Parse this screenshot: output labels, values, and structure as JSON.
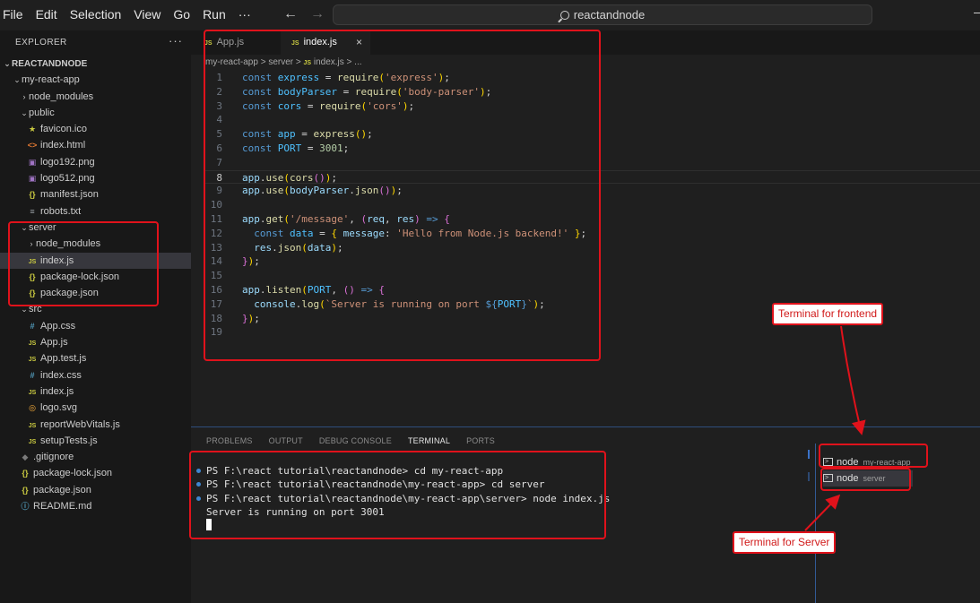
{
  "menu": [
    "File",
    "Edit",
    "Selection",
    "View",
    "Go",
    "Run",
    "···"
  ],
  "search": {
    "text": "reactandnode"
  },
  "sidebar": {
    "title": "EXPLORER",
    "more": "···",
    "tree": [
      {
        "label": "REACTANDNODE",
        "depth": 0,
        "type": "folder",
        "open": true,
        "root": true
      },
      {
        "label": "my-react-app",
        "depth": 1,
        "type": "folder",
        "open": true
      },
      {
        "label": "node_modules",
        "depth": 2,
        "type": "folder",
        "open": false
      },
      {
        "label": "public",
        "depth": 2,
        "type": "folder",
        "open": true
      },
      {
        "label": "favicon.ico",
        "depth": 3,
        "type": "star"
      },
      {
        "label": "index.html",
        "depth": 3,
        "type": "html"
      },
      {
        "label": "logo192.png",
        "depth": 3,
        "type": "img"
      },
      {
        "label": "logo512.png",
        "depth": 3,
        "type": "img"
      },
      {
        "label": "manifest.json",
        "depth": 3,
        "type": "json"
      },
      {
        "label": "robots.txt",
        "depth": 3,
        "type": "txt"
      },
      {
        "label": "server",
        "depth": 2,
        "type": "folder",
        "open": true
      },
      {
        "label": "node_modules",
        "depth": 3,
        "type": "folder",
        "open": false
      },
      {
        "label": "index.js",
        "depth": 3,
        "type": "js",
        "selected": true
      },
      {
        "label": "package-lock.json",
        "depth": 3,
        "type": "json"
      },
      {
        "label": "package.json",
        "depth": 3,
        "type": "json"
      },
      {
        "label": "src",
        "depth": 2,
        "type": "folder",
        "open": true
      },
      {
        "label": "App.css",
        "depth": 3,
        "type": "css"
      },
      {
        "label": "App.js",
        "depth": 3,
        "type": "js"
      },
      {
        "label": "App.test.js",
        "depth": 3,
        "type": "js"
      },
      {
        "label": "index.css",
        "depth": 3,
        "type": "css"
      },
      {
        "label": "index.js",
        "depth": 3,
        "type": "js"
      },
      {
        "label": "logo.svg",
        "depth": 3,
        "type": "svg"
      },
      {
        "label": "reportWebVitals.js",
        "depth": 3,
        "type": "js"
      },
      {
        "label": "setupTests.js",
        "depth": 3,
        "type": "js"
      },
      {
        "label": ".gitignore",
        "depth": 2,
        "type": "git"
      },
      {
        "label": "package-lock.json",
        "depth": 2,
        "type": "json"
      },
      {
        "label": "package.json",
        "depth": 2,
        "type": "json"
      },
      {
        "label": "README.md",
        "depth": 2,
        "type": "info"
      }
    ]
  },
  "editor": {
    "tabs": [
      {
        "label": "App.js",
        "icon": "JS"
      },
      {
        "label": "index.js",
        "icon": "JS",
        "close": "×"
      }
    ],
    "breadcrumb": {
      "parts": [
        "my-react-app",
        "server"
      ],
      "file": "index.js",
      "sep": ">",
      "tail": "..."
    },
    "current_line": 8,
    "code": [
      [
        [
          "kw",
          "const "
        ],
        [
          "vr",
          "express"
        ],
        [
          "pu",
          " = "
        ],
        [
          "fn",
          "require"
        ],
        [
          "br1",
          "("
        ],
        [
          "st",
          "'express'"
        ],
        [
          "br1",
          ")"
        ],
        [
          "pu",
          ";"
        ]
      ],
      [
        [
          "kw",
          "const "
        ],
        [
          "vr",
          "bodyParser"
        ],
        [
          "pu",
          " = "
        ],
        [
          "fn",
          "require"
        ],
        [
          "br1",
          "("
        ],
        [
          "st",
          "'body-parser'"
        ],
        [
          "br1",
          ")"
        ],
        [
          "pu",
          ";"
        ]
      ],
      [
        [
          "kw",
          "const "
        ],
        [
          "vr",
          "cors"
        ],
        [
          "pu",
          " = "
        ],
        [
          "fn",
          "require"
        ],
        [
          "br1",
          "("
        ],
        [
          "st",
          "'cors'"
        ],
        [
          "br1",
          ")"
        ],
        [
          "pu",
          ";"
        ]
      ],
      [],
      [
        [
          "kw",
          "const "
        ],
        [
          "vr",
          "app"
        ],
        [
          "pu",
          " = "
        ],
        [
          "fn",
          "express"
        ],
        [
          "br1",
          "()"
        ],
        [
          "pu",
          ";"
        ]
      ],
      [
        [
          "kw",
          "const "
        ],
        [
          "vr",
          "PORT"
        ],
        [
          "pu",
          " = "
        ],
        [
          "nu",
          "3001"
        ],
        [
          "pu",
          ";"
        ]
      ],
      [],
      [
        [
          "pr",
          "app"
        ],
        [
          "pu",
          "."
        ],
        [
          "fn",
          "use"
        ],
        [
          "br1",
          "("
        ],
        [
          "fn",
          "cors"
        ],
        [
          "br2",
          "()"
        ],
        [
          "br1",
          ")"
        ],
        [
          "pu",
          ";"
        ]
      ],
      [
        [
          "pr",
          "app"
        ],
        [
          "pu",
          "."
        ],
        [
          "fn",
          "use"
        ],
        [
          "br1",
          "("
        ],
        [
          "pr",
          "bodyParser"
        ],
        [
          "pu",
          "."
        ],
        [
          "fn",
          "json"
        ],
        [
          "br2",
          "()"
        ],
        [
          "br1",
          ")"
        ],
        [
          "pu",
          ";"
        ]
      ],
      [],
      [
        [
          "pr",
          "app"
        ],
        [
          "pu",
          "."
        ],
        [
          "fn",
          "get"
        ],
        [
          "br1",
          "("
        ],
        [
          "st",
          "'/message'"
        ],
        [
          "pu",
          ", "
        ],
        [
          "br2",
          "("
        ],
        [
          "pm",
          "req"
        ],
        [
          "pu",
          ", "
        ],
        [
          "pm",
          "res"
        ],
        [
          "br2",
          ")"
        ],
        [
          "kw",
          " => "
        ],
        [
          "br2",
          "{"
        ]
      ],
      [
        [
          "pu",
          "  "
        ],
        [
          "kw",
          "const "
        ],
        [
          "vr",
          "data"
        ],
        [
          "pu",
          " = "
        ],
        [
          "br1",
          "{"
        ],
        [
          "pr",
          " message"
        ],
        [
          "pu",
          ": "
        ],
        [
          "st",
          "'Hello from Node.js backend!'"
        ],
        [
          "br1",
          " }"
        ],
        [
          "pu",
          ";"
        ]
      ],
      [
        [
          "pu",
          "  "
        ],
        [
          "pm",
          "res"
        ],
        [
          "pu",
          "."
        ],
        [
          "fn",
          "json"
        ],
        [
          "br1",
          "("
        ],
        [
          "pr",
          "data"
        ],
        [
          "br1",
          ")"
        ],
        [
          "pu",
          ";"
        ]
      ],
      [
        [
          "br2",
          "}"
        ],
        [
          "br1",
          ")"
        ],
        [
          "pu",
          ";"
        ]
      ],
      [],
      [
        [
          "pr",
          "app"
        ],
        [
          "pu",
          "."
        ],
        [
          "fn",
          "listen"
        ],
        [
          "br1",
          "("
        ],
        [
          "vr",
          "PORT"
        ],
        [
          "pu",
          ", "
        ],
        [
          "br2",
          "()"
        ],
        [
          "kw",
          " => "
        ],
        [
          "br2",
          "{"
        ]
      ],
      [
        [
          "pu",
          "  "
        ],
        [
          "pr",
          "console"
        ],
        [
          "pu",
          "."
        ],
        [
          "fn",
          "log"
        ],
        [
          "br1",
          "("
        ],
        [
          "st",
          "`Server is running on port "
        ],
        [
          "kw",
          "${"
        ],
        [
          "vr",
          "PORT"
        ],
        [
          "kw",
          "}"
        ],
        [
          "st",
          "`"
        ],
        [
          "br1",
          ")"
        ],
        [
          "pu",
          ";"
        ]
      ],
      [
        [
          "br2",
          "}"
        ],
        [
          "br1",
          ")"
        ],
        [
          "pu",
          ";"
        ]
      ],
      []
    ]
  },
  "panel": {
    "tabs": [
      "PROBLEMS",
      "OUTPUT",
      "DEBUG CONSOLE",
      "TERMINAL",
      "PORTS"
    ],
    "active_tab": "TERMINAL",
    "terminal_lines": [
      {
        "text": "PS F:\\react tutorial\\reactandnode> cd my-react-app",
        "dot": true
      },
      {
        "text": "PS F:\\react tutorial\\reactandnode\\my-react-app> cd server",
        "dot": true
      },
      {
        "text": "PS F:\\react tutorial\\reactandnode\\my-react-app\\server> node index.js",
        "dot": true
      },
      {
        "text": "Server is running on port 3001",
        "dot": false
      }
    ],
    "terminals": [
      {
        "name": "node",
        "sub": "my-react-app"
      },
      {
        "name": "node",
        "sub": "server"
      }
    ]
  },
  "annotations": {
    "frontend": "Terminal for frontend",
    "server": "Terminal for Server",
    "color": "#e0121b"
  }
}
